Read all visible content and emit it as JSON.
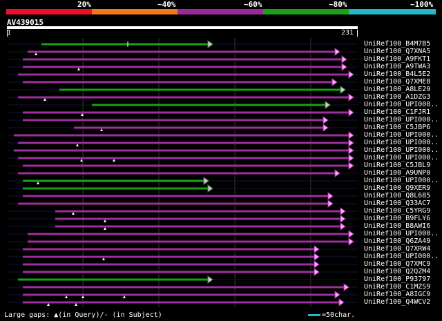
{
  "legend": {
    "labels": [
      "20%",
      "~40%",
      "~60%",
      "~80%",
      "~100%"
    ],
    "colors": [
      "#e8102a",
      "#ee7a1a",
      "#9a2a9a",
      "#1aa01a",
      "#22b8c8"
    ]
  },
  "query": {
    "name": "AV439015",
    "start": "1",
    "end": "231"
  },
  "hits": [
    {
      "name": "UniRef100_B4M7B5",
      "color": "green"
    },
    {
      "name": "UniRef100_Q7XNA5",
      "color": "purple"
    },
    {
      "name": "UniRef100_A9FKT1",
      "color": "purple"
    },
    {
      "name": "UniRef100_A9TWA3",
      "color": "purple"
    },
    {
      "name": "UniRef100_B4L5E2",
      "color": "purple"
    },
    {
      "name": "UniRef100_Q7XME8",
      "color": "purple"
    },
    {
      "name": "UniRef100_A8LE29",
      "color": "green"
    },
    {
      "name": "UniRef100_A1DZG3",
      "color": "purple"
    },
    {
      "name": "UniRef100_UPI000..",
      "color": "green"
    },
    {
      "name": "UniRef100_C1FJR1",
      "color": "purple"
    },
    {
      "name": "UniRef100_UPI000..",
      "color": "purple"
    },
    {
      "name": "UniRef100_C5JBP6",
      "color": "purple"
    },
    {
      "name": "UniRef100_UPI000..",
      "color": "purple"
    },
    {
      "name": "UniRef100_UPI000..",
      "color": "purple"
    },
    {
      "name": "UniRef100_UPI000..",
      "color": "purple"
    },
    {
      "name": "UniRef100_UPI000..",
      "color": "purple"
    },
    {
      "name": "UniRef100_C5JBL9",
      "color": "purple"
    },
    {
      "name": "UniRef100_A9UNP0",
      "color": "purple"
    },
    {
      "name": "UniRef100_UPI000..",
      "color": "green"
    },
    {
      "name": "UniRef100_Q9XER9",
      "color": "green"
    },
    {
      "name": "UniRef100_Q8L685",
      "color": "purple"
    },
    {
      "name": "UniRef100_Q33AC7",
      "color": "purple"
    },
    {
      "name": "UniRef100_C5YRG9",
      "color": "purple"
    },
    {
      "name": "UniRef100_B9FLY6",
      "color": "purple"
    },
    {
      "name": "UniRef100_B8AWI6",
      "color": "purple"
    },
    {
      "name": "UniRef100_UPI000..",
      "color": "purple"
    },
    {
      "name": "UniRef100_Q6ZA49",
      "color": "purple"
    },
    {
      "name": "UniRef100_Q7XRW4",
      "color": "purple"
    },
    {
      "name": "UniRef100_UPI000..",
      "color": "purple"
    },
    {
      "name": "UniRef100_Q7XMC9",
      "color": "purple"
    },
    {
      "name": "UniRef100_Q2QZM4",
      "color": "purple"
    },
    {
      "name": "UniRef100_P93797",
      "color": "green"
    },
    {
      "name": "UniRef100_C1MZS9",
      "color": "purple"
    },
    {
      "name": "UniRef100_A8IGC9",
      "color": "purple"
    },
    {
      "name": "UniRef100_Q4WCV2",
      "color": "purple"
    }
  ],
  "footer": {
    "gaps_text": "Large gaps: ▲(in Query)/- (in Subject)",
    "scale_text": "=50char."
  }
}
